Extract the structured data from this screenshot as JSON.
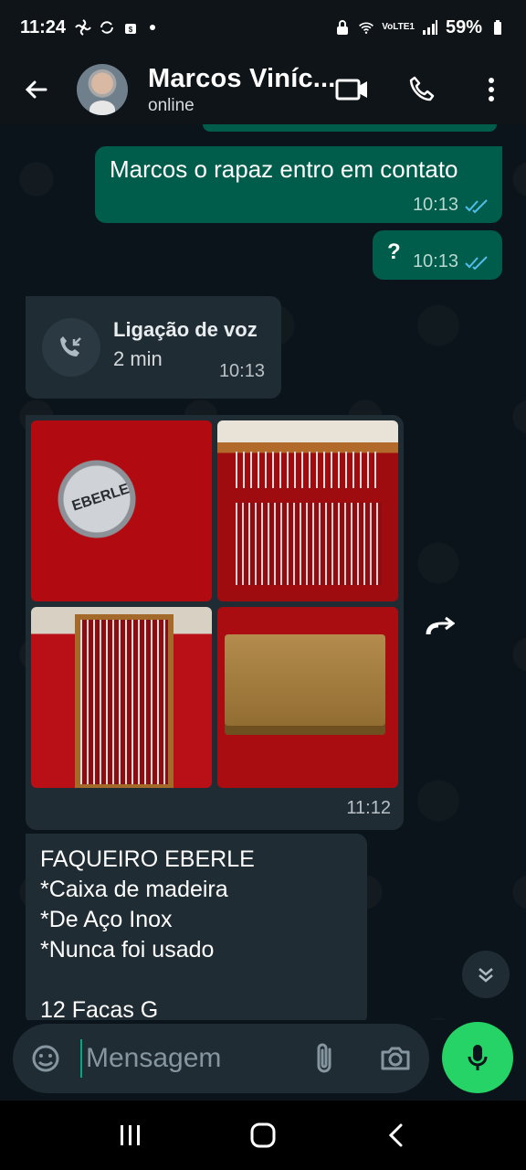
{
  "status_bar": {
    "time": "11:24",
    "battery": "59%",
    "network_label": "VoLTE1"
  },
  "header": {
    "contact_name": "Marcos Viníc...",
    "contact_status": "online"
  },
  "messages": {
    "outgoing_1": {
      "text": "Marcos o rapaz entro em contato",
      "time": "10:13"
    },
    "outgoing_2": {
      "text": "?",
      "time": "10:13"
    },
    "call": {
      "title": "Ligação de voz",
      "duration": "2 min",
      "time": "10:13"
    },
    "album": {
      "time": "11:12",
      "photo_label": "EBERLE"
    },
    "description": {
      "lines": [
        "FAQUEIRO EBERLE",
        "*Caixa de madeira",
        "*De Aço Inox",
        "*Nunca foi usado",
        "",
        "12 Facas G"
      ]
    }
  },
  "composer": {
    "placeholder": "Mensagem"
  },
  "colors": {
    "outgoing_bubble": "#005c4b",
    "incoming_bubble": "#1f2c34",
    "accent_green": "#25d366",
    "background": "#0b141a"
  },
  "icons": [
    "back-arrow-icon",
    "video-call-icon",
    "voice-call-icon",
    "more-options-icon",
    "incoming-call-icon",
    "forward-icon",
    "double-check-icon",
    "scroll-down-icon",
    "sticker-icon",
    "attach-icon",
    "camera-icon",
    "mic-icon",
    "recent-apps-icon",
    "home-icon",
    "back-icon"
  ]
}
